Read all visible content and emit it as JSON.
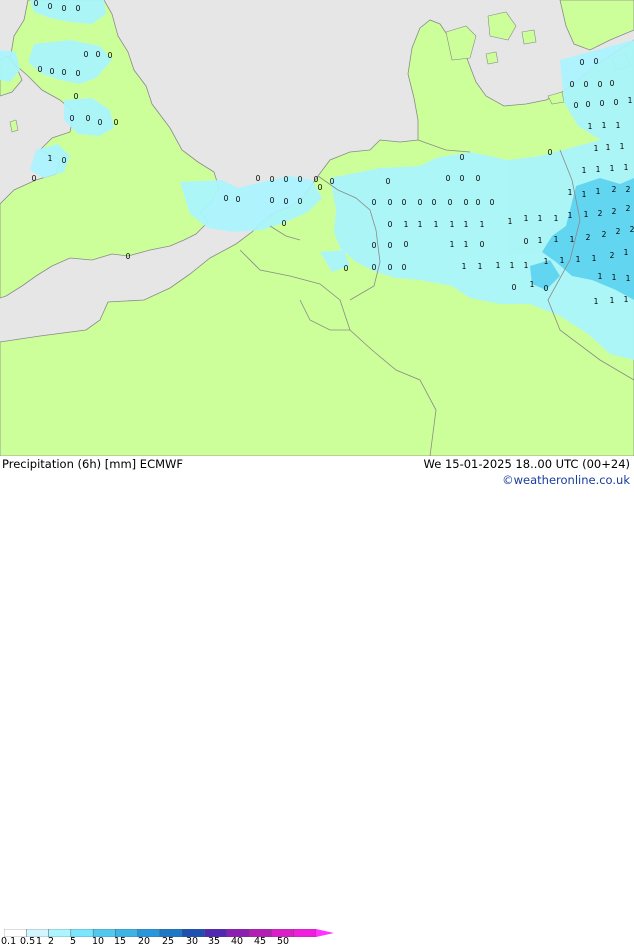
{
  "header": {
    "title": "Precipitation (6h) [mm] ECMWF",
    "datetime": "We 15-01-2025 18..00 UTC (00+24)",
    "credit": "©weatheronline.co.uk"
  },
  "map": {
    "colors": {
      "sea": "#e6e6e6",
      "land": "#ccff99",
      "light_precip": "#aaf5ff",
      "medium_precip": "#5ad2f0",
      "border": "#8a8a8a"
    },
    "labels": [
      "1",
      "2",
      "0"
    ]
  },
  "legend": {
    "ticks": [
      "0.1",
      "0.5",
      "1",
      "2",
      "5",
      "10",
      "15",
      "20",
      "25",
      "30",
      "35",
      "40",
      "45",
      "50"
    ],
    "colors": [
      "#ffffff",
      "#d2f5ff",
      "#aaf5ff",
      "#78e6ff",
      "#50c8f0",
      "#3cb4e6",
      "#2896dc",
      "#1e78c8",
      "#1e50b4",
      "#5028b4",
      "#8c1eb4",
      "#b41eb4",
      "#dc1ec8",
      "#f01edc",
      "#ff32ff"
    ]
  }
}
